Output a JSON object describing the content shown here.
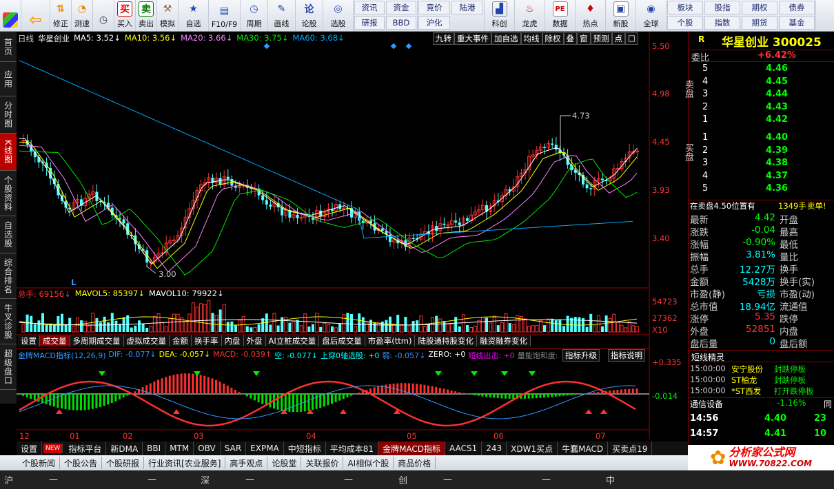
{
  "toolbar": {
    "buttons": [
      {
        "label": "",
        "icon": "windows-icon"
      },
      {
        "label": "",
        "icon": "back-arrow-icon"
      },
      {
        "label": "修正",
        "icon": "fix-icon"
      },
      {
        "label": "测速",
        "icon": "speed-icon"
      },
      {
        "label": "",
        "icon": "clock-icon"
      },
      {
        "label": "买入",
        "icon": "buy-icon"
      },
      {
        "label": "卖出",
        "icon": "sell-icon"
      },
      {
        "label": "模拟",
        "icon": "hammer-icon"
      },
      {
        "label": "自选",
        "icon": "star-icon"
      },
      {
        "label": "F10/F9",
        "icon": "f10-icon"
      },
      {
        "label": "周期",
        "icon": "period-icon"
      },
      {
        "label": "画线",
        "icon": "draw-icon"
      },
      {
        "label": "论股",
        "icon": "forum-icon"
      },
      {
        "label": "选股",
        "icon": "select-icon"
      }
    ],
    "grid1": [
      "资讯",
      "资金",
      "研报",
      "BBD"
    ],
    "grid2": [
      "竞价",
      "陆港",
      "沪化"
    ],
    "mid": [
      {
        "label": "科创",
        "icon": "chart-icon"
      },
      {
        "label": "龙虎",
        "icon": "dragon-icon"
      },
      {
        "label": "数据",
        "icon": "pe-icon"
      },
      {
        "label": "热点",
        "icon": "hot-icon"
      },
      {
        "label": "新股",
        "icon": "ipo-icon"
      },
      {
        "label": "全球",
        "icon": "globe-icon"
      }
    ],
    "grid3": [
      "板块",
      "股指",
      "期权",
      "债券",
      "个股",
      "指数",
      "期货",
      "基金"
    ]
  },
  "leftnav": [
    "首页",
    "应用",
    "分时图",
    "K线图",
    "个股资料",
    "自选股",
    "综合排名",
    "牛叉诊股",
    "超级盘口"
  ],
  "kline_header": {
    "type": "日线",
    "stock": "华星创业",
    "ma5": "MA5: 3.52↓",
    "ma10": "MA10: 3.56↓",
    "ma20": "MA20: 3.66↓",
    "ma30": "MA30: 3.75↓",
    "ma60": "MA60: 3.68↓",
    "tools": [
      "九转",
      "重大事件",
      "加自选",
      "均线",
      "除权",
      "叠",
      "窗",
      "预测",
      "点",
      "□"
    ]
  },
  "price_axis": [
    "5.50",
    "4.98",
    "4.45",
    "3.93",
    "3.40"
  ],
  "annotations": {
    "high": "4.73",
    "low": "3.00",
    "marker_l": "L"
  },
  "volume_header": {
    "total": "总手: 69156↓",
    "mavol5": "MAVOL5: 85397↓",
    "mavol10": "MAVOL10: 79922↓"
  },
  "volume_axis": [
    "54723",
    "27362",
    "X10"
  ],
  "sub_tabs": [
    "设置",
    "成交量",
    "多周期成交量",
    "虚拟成交量",
    "金额",
    "换手率",
    "内盘",
    "外盘",
    "AI立桩成交量",
    "盘后成交量",
    "市盈率(ttm)",
    "陆股通持股变化",
    "融资融券变化"
  ],
  "macd_header": {
    "name": "金牌MACD指标(12,26,9)",
    "dif": "DIF: -0.077↓",
    "dea": "DEA: -0.057↓",
    "macd": "MACD: -0.039↑",
    "kong": "空: -0.077↓",
    "shang": "上穿0轴选股: +0",
    "ruo": "弱: -0.057↓",
    "zero": "ZERO: +0",
    "duan": "短线出击: +0",
    "liang": "量能饱和度: +3",
    "btn1": "指标升级",
    "btn2": "指标说明"
  },
  "macd_axis": [
    "+0.335",
    "-0.014"
  ],
  "months": [
    "12",
    "01",
    "02",
    "03",
    "04",
    "05",
    "06",
    "07"
  ],
  "bottom_tabs": [
    "设置",
    "NEW",
    "指标平台",
    "新DMA",
    "BBI",
    "MTM",
    "OBV",
    "SAR",
    "EXPMA",
    "中短指标",
    "平均成本81",
    "金牌MACD指标",
    "AACS1",
    "243",
    "XDW1买点",
    "牛蠢MACD",
    "买卖点19"
  ],
  "newsbar": [
    "个股新闻",
    "个股公告",
    "个股研报",
    "行业资讯[农业服务]",
    "高手观点",
    "论股堂",
    "关联报价",
    "AI相似个股",
    "商品价格"
  ],
  "statusbar": {
    "sh": "沪",
    "sz": "深",
    "cy": "创",
    "zh": "中",
    "dash": "—"
  },
  "right": {
    "R": "R",
    "title": "华星创业 300025",
    "weibi_label": "委比",
    "weibi": "+6.42%",
    "sell_label": "卖盘",
    "buy_label": "买盘",
    "sells": [
      {
        "n": "5",
        "p": "4.46"
      },
      {
        "n": "4",
        "p": "4.45"
      },
      {
        "n": "3",
        "p": "4.44"
      },
      {
        "n": "2",
        "p": "4.43"
      },
      {
        "n": "1",
        "p": "4.42"
      }
    ],
    "buys": [
      {
        "n": "1",
        "p": "4.40"
      },
      {
        "n": "2",
        "p": "4.39"
      },
      {
        "n": "3",
        "p": "4.38"
      },
      {
        "n": "4",
        "p": "4.37"
      },
      {
        "n": "5",
        "p": "4.36"
      }
    ],
    "notice": "在卖盘4.50位置有",
    "notice_vol": "1349手",
    "notice_tag": "卖单!",
    "stats": [
      [
        "最新",
        "4.42",
        "开盘",
        ""
      ],
      [
        "涨跌",
        "-0.04",
        "最高",
        ""
      ],
      [
        "涨幅",
        "-0.90%",
        "最低",
        ""
      ],
      [
        "振幅",
        "3.81%",
        "量比",
        ""
      ],
      [
        "总手",
        "12.27万",
        "换手",
        ""
      ],
      [
        "金额",
        "5428万",
        "换手(实)",
        ""
      ],
      [
        "市盈(静)",
        "亏损",
        "市盈(动)",
        ""
      ],
      [
        "总市值",
        "18.94亿",
        "流通值",
        ""
      ],
      [
        "涨停",
        "5.35",
        "跌停",
        ""
      ],
      [
        "外盘",
        "52851",
        "内盘",
        ""
      ],
      [
        "盘后量",
        "0",
        "盘后额",
        ""
      ]
    ],
    "jingling_title": "短线精灵",
    "jingling": [
      {
        "t": "15:00:00",
        "n": "安宁股份",
        "e": "封跌停板"
      },
      {
        "t": "15:00:00",
        "n": "ST柏龙",
        "e": "封跌停板"
      },
      {
        "t": "15:00:00",
        "n": "*ST西发",
        "e": "打开跌停板"
      }
    ],
    "industry": "通信设备",
    "industry_pct": "-1.16%",
    "industry_tag": "同",
    "ticks": [
      {
        "t": "14:56",
        "p": "4.40",
        "v": "23"
      },
      {
        "t": "14:57",
        "p": "4.41",
        "v": "10"
      }
    ]
  },
  "logo": {
    "cn": "分析家公式网",
    "url": "WWW.70822.COM"
  },
  "colors": {
    "up": "#ff3232",
    "down": "#54ffff",
    "ma5": "#ffffff",
    "ma10": "#ffff00",
    "ma20": "#ff80ff",
    "ma30": "#00e600",
    "ma60": "#00aaff",
    "axis": "#a00000"
  }
}
